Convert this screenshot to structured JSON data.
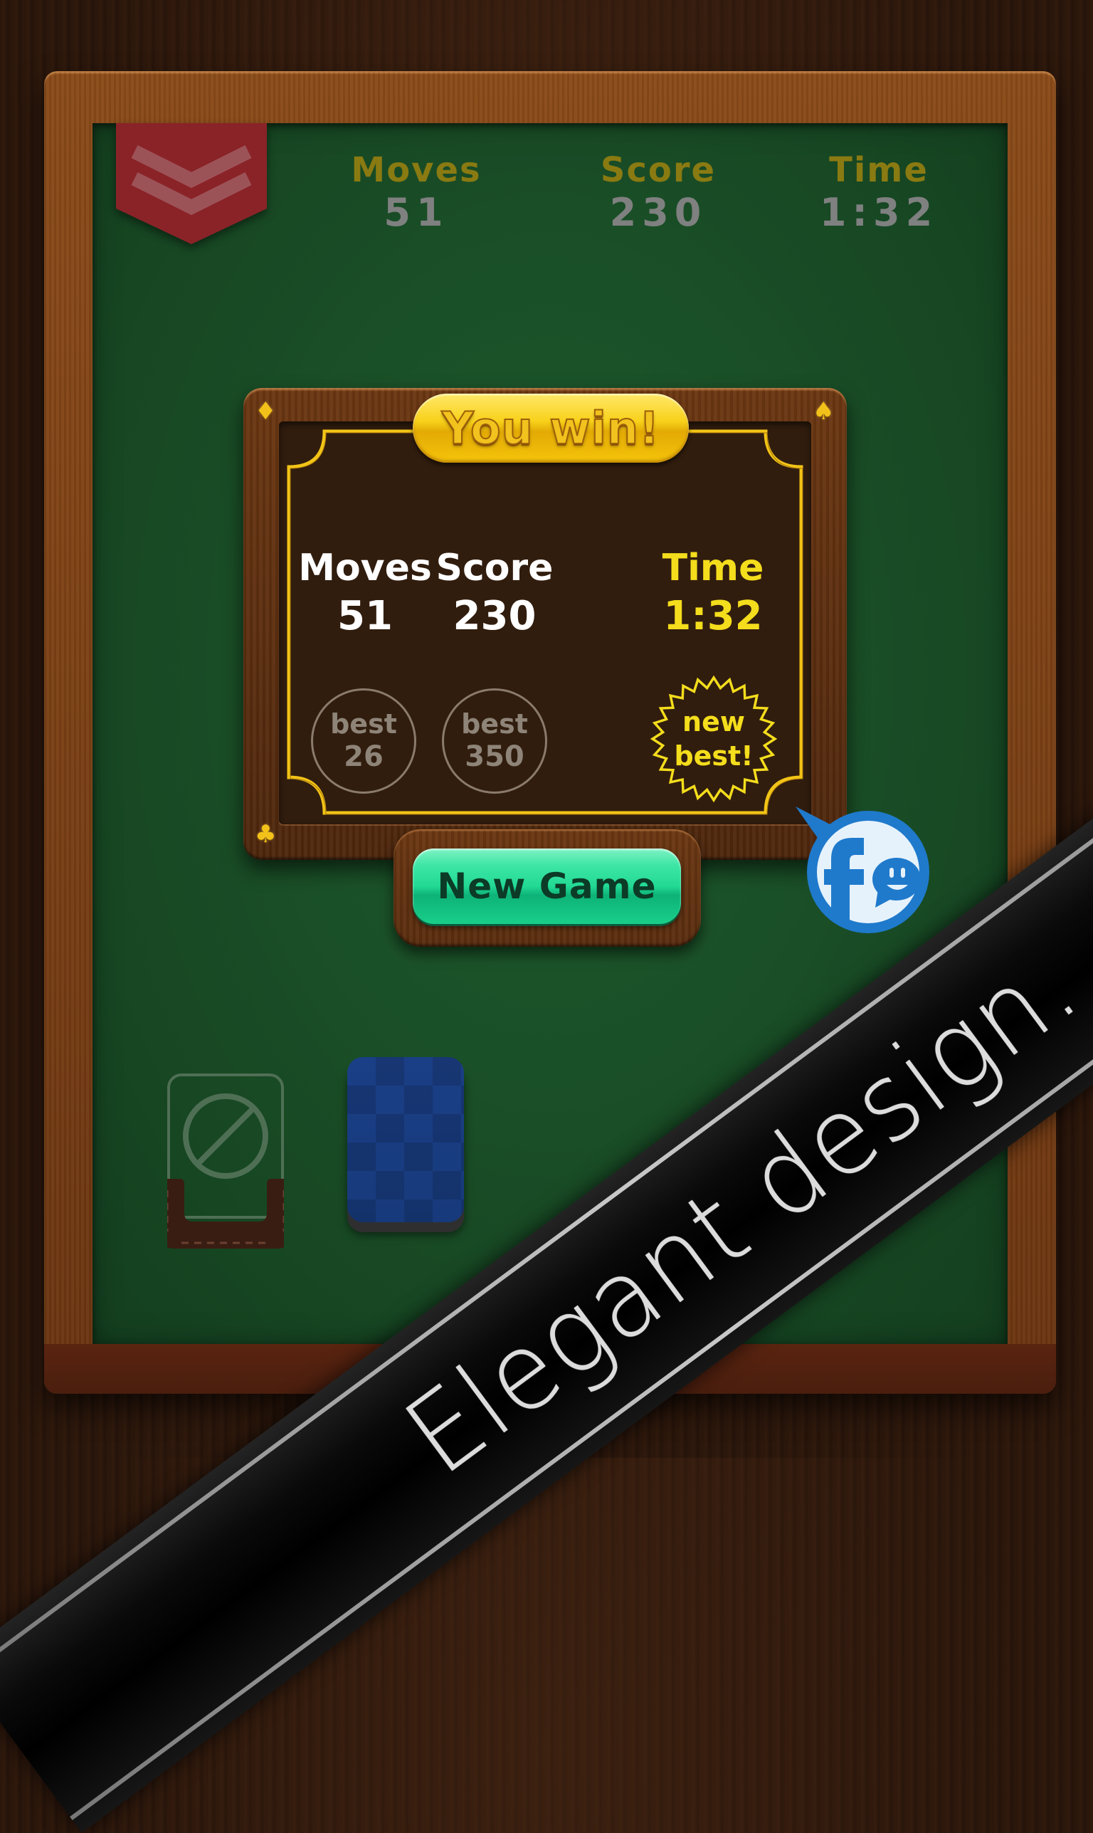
{
  "hud": {
    "moves": {
      "label": "Moves",
      "value": "51"
    },
    "score": {
      "label": "Score",
      "value": "230"
    },
    "time": {
      "label": "Time",
      "value": "1:32"
    }
  },
  "menu": {
    "icon": "chevron-menu-icon"
  },
  "win_dialog": {
    "title": "You win!",
    "stats": [
      {
        "label": "Moves",
        "value": "51",
        "best_label": "best",
        "best_value": "26",
        "new_best": false
      },
      {
        "label": "Score",
        "value": "230",
        "best_label": "best",
        "best_value": "350",
        "new_best": false
      },
      {
        "label": "Time",
        "value": "1:32",
        "new_best": true,
        "new_best_line1": "new",
        "new_best_line2": "best!"
      }
    ],
    "corner_suits": {
      "top_left": "♦",
      "top_right": "♠",
      "bottom_left": "♣"
    },
    "new_game_label": "New Game"
  },
  "share": {
    "icon": "facebook-share-icon"
  },
  "piles": {
    "stock_empty_icon": "no-entry-icon",
    "waste_icon": "card-back"
  },
  "promo": {
    "text": "Elegant design."
  },
  "colors": {
    "felt": "#1a4f27",
    "wood": "#7a3f14",
    "gold": "#f4dd1c",
    "button_green": "#22d994",
    "facebook_blue": "#1f7acc",
    "ribbon_red": "#8f2126"
  }
}
